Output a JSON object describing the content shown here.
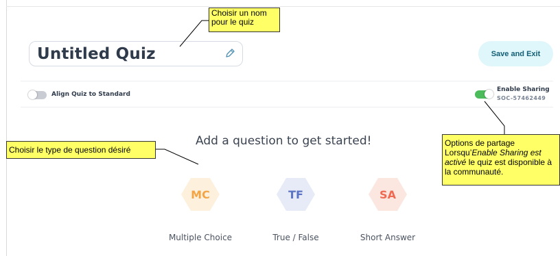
{
  "quiz": {
    "title": "Untitled Quiz",
    "save_label": "Save and Exit"
  },
  "options": {
    "align_label": "Align Quiz to Standard",
    "align_on": false,
    "sharing_label": "Enable Sharing",
    "sharing_code": "SOC-57462449",
    "sharing_on": true
  },
  "main": {
    "headline": "Add a question to get started!",
    "question_types": [
      {
        "abbr": "MC",
        "label": "Multiple Choice",
        "color": "#f3a546",
        "bg": "#fdf1dd",
        "icon": "hexagon"
      },
      {
        "abbr": "TF",
        "label": "True / False",
        "color": "#5b73c4",
        "bg": "#e7ebf7",
        "icon": "hexagon"
      },
      {
        "abbr": "SA",
        "label": "Short Answer",
        "color": "#ee6a52",
        "bg": "#fce6e0",
        "icon": "hexagon"
      }
    ]
  },
  "annotations": {
    "name_note": [
      "Choisir un nom",
      "pour le quiz"
    ],
    "type_note": "Choisir le type de question désiré",
    "share_note": {
      "title": "Options de partage",
      "line_prefix": "Lorsqu’",
      "line_italic": "Enable Sharing est activé",
      "line_suffix": " le quiz est disponible à la communauté."
    }
  },
  "colors": {
    "toggle_on": "#4cbb5c",
    "toggle_off": "#c9ccd3",
    "callout": "#ffff66"
  }
}
